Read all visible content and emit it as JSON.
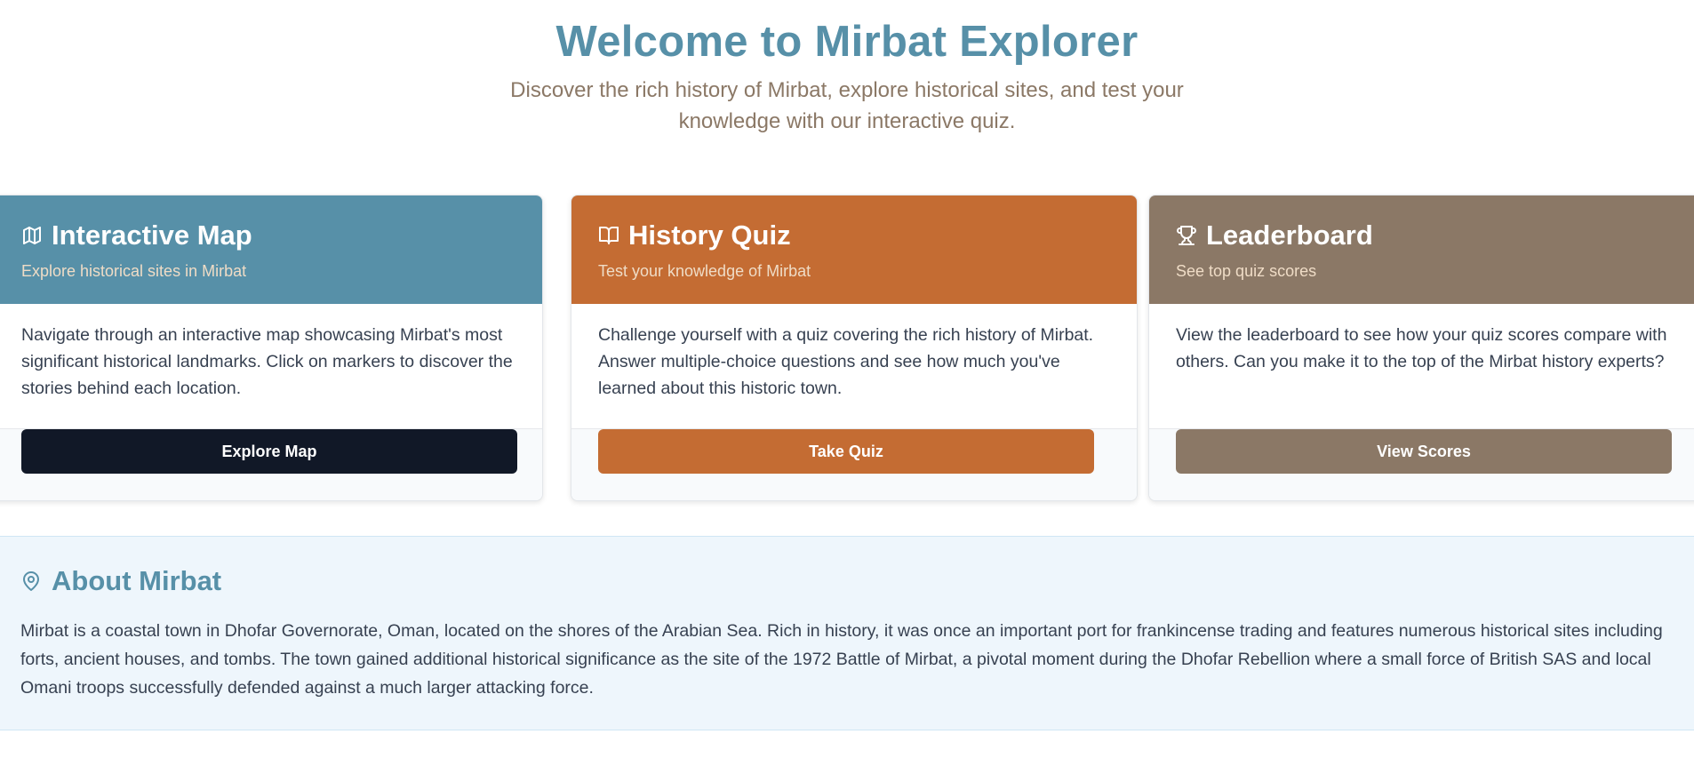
{
  "hero": {
    "title": "Welcome to Mirbat Explorer",
    "subtitle": "Discover the rich history of Mirbat, explore historical sites, and test your knowledge with our interactive quiz."
  },
  "cards": [
    {
      "icon": "map-icon",
      "title": "Interactive Map",
      "subtitle": "Explore historical sites in Mirbat",
      "body": "Navigate through an interactive map showcasing Mirbat's most significant historical landmarks. Click on markers to discover the stories behind each location.",
      "button_label": "Explore Map",
      "header_color": "#5790a8",
      "button_color": "#111827"
    },
    {
      "icon": "book-open-icon",
      "title": "History Quiz",
      "subtitle": "Test your knowledge of Mirbat",
      "body": "Challenge yourself with a quiz covering the rich history of Mirbat. Answer multiple-choice questions and see how much you've learned about this historic town.",
      "button_label": "Take Quiz",
      "header_color": "#c46c33",
      "button_color": "#c46c33"
    },
    {
      "icon": "trophy-icon",
      "title": "Leaderboard",
      "subtitle": "See top quiz scores",
      "body": "View the leaderboard to see how your quiz scores compare with others. Can you make it to the top of the Mirbat history experts?",
      "button_label": "View Scores",
      "header_color": "#8b7866",
      "button_color": "#8b7866"
    }
  ],
  "about": {
    "icon": "map-pin-icon",
    "title": "About Mirbat",
    "text": "Mirbat is a coastal town in Dhofar Governorate, Oman, located on the shores of the Arabian Sea. Rich in history, it was once an important port for frankincense trading and features numerous historical sites including forts, ancient houses, and tombs. The town gained additional historical significance as the site of the 1972 Battle of Mirbat, a pivotal moment during the Dhofar Rebellion where a small force of British SAS and local Omani troops successfully defended against a much larger attacking force."
  },
  "colors": {
    "primary": "#5790a8",
    "accent": "#c46c33",
    "muted": "#8b7866",
    "dark": "#111827",
    "about_bg": "#eef6fc"
  }
}
